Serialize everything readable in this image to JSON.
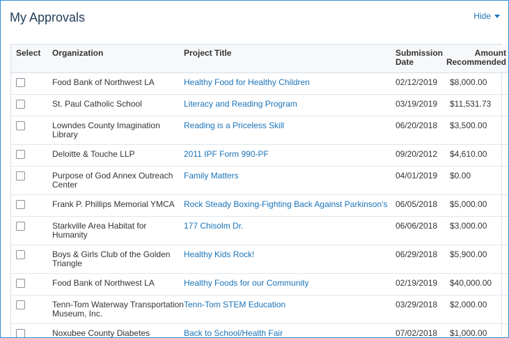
{
  "header": {
    "title": "My Approvals",
    "hide_label": "Hide"
  },
  "table": {
    "columns": {
      "select": "Select",
      "organization": "Organization",
      "project_title": "Project Title",
      "submission_date": "Submission Date",
      "amount_recommended": "Amount Recommended"
    },
    "rows": [
      {
        "organization": "Food Bank of Northwest LA",
        "project_title": "Healthy Food for Healthy Children",
        "submission_date": "02/12/2019",
        "amount": "$8,000.00"
      },
      {
        "organization": "St. Paul Catholic School",
        "project_title": "Literacy and Reading Program",
        "submission_date": "03/19/2019",
        "amount": "$11,531.73"
      },
      {
        "organization": "Lowndes County Imagination Library",
        "project_title": "Reading is a Priceless Skill",
        "submission_date": "06/20/2018",
        "amount": "$3,500.00"
      },
      {
        "organization": "Deloitte & Touche LLP",
        "project_title": "2011 IPF Form 990-PF",
        "submission_date": "09/20/2012",
        "amount": "$4,610.00"
      },
      {
        "organization": "Purpose of God Annex Outreach Center",
        "project_title": "Family Matters",
        "submission_date": "04/01/2019",
        "amount": "$0.00"
      },
      {
        "organization": "Frank P. Phillips Memorial YMCA",
        "project_title": "Rock Steady Boxing-Fighting Back Against Parkinson's",
        "submission_date": "06/05/2018",
        "amount": "$5,000.00"
      },
      {
        "organization": "Starkville Area Habitat for Humanity",
        "project_title": "177 Chisolm Dr.",
        "submission_date": "06/06/2018",
        "amount": "$3,000.00"
      },
      {
        "organization": "Boys & Girls Club of the Golden Triangle",
        "project_title": "Healthy Kids Rock!",
        "submission_date": "06/29/2018",
        "amount": "$5,900.00"
      },
      {
        "organization": "Food Bank of Northwest LA",
        "project_title": "Healthy Foods for our Community",
        "submission_date": "02/19/2019",
        "amount": "$40,000.00"
      },
      {
        "organization": "Tenn-Tom Waterway Transportation Museum, Inc.",
        "project_title": "Tenn-Tom STEM Education",
        "submission_date": "03/29/2018",
        "amount": "$2,000.00"
      },
      {
        "organization": "Noxubee County Diabetes Coalition",
        "project_title": "Back to School/Health Fair",
        "submission_date": "07/02/2018",
        "amount": "$1,000.00"
      }
    ]
  }
}
